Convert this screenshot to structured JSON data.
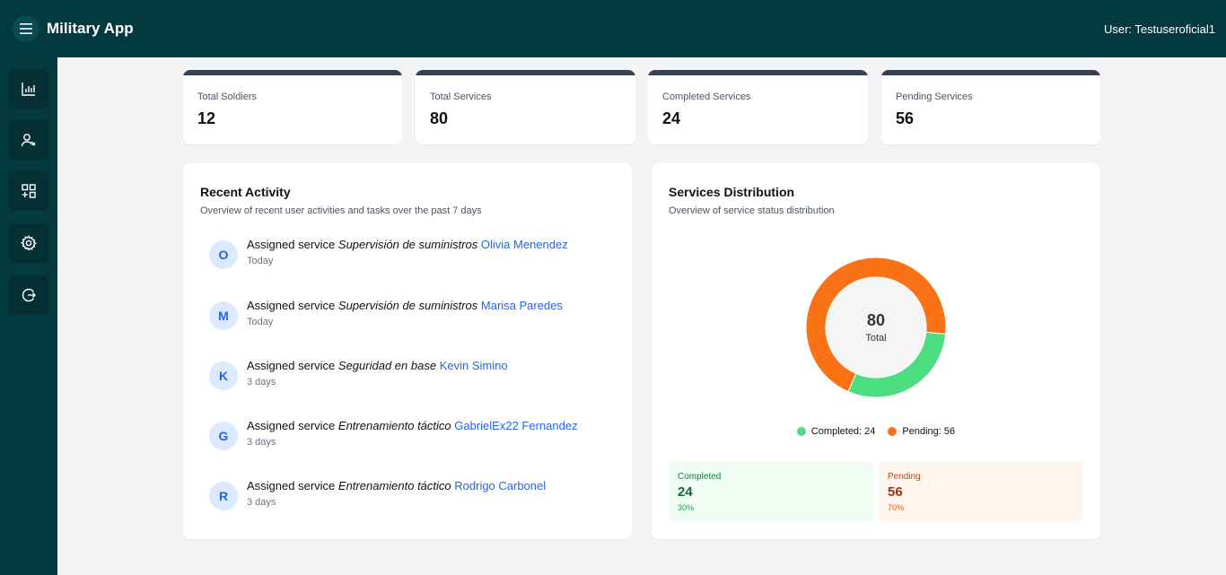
{
  "header": {
    "app_title": "Military App",
    "user_label": "User: Testuseroficial1"
  },
  "sidebar": {
    "items": [
      {
        "icon": "bar-chart-icon"
      },
      {
        "icon": "users-icon"
      },
      {
        "icon": "grid-add-icon"
      },
      {
        "icon": "gear-icon"
      },
      {
        "icon": "logout-icon"
      }
    ]
  },
  "stats": [
    {
      "label": "Total Soldiers",
      "value": "12"
    },
    {
      "label": "Total Services",
      "value": "80"
    },
    {
      "label": "Completed Services",
      "value": "24"
    },
    {
      "label": "Pending Services",
      "value": "56"
    }
  ],
  "activity": {
    "title": "Recent Activity",
    "subtitle": "Overview of recent user activities and tasks over the past 7 days",
    "action_text": "Assigned service",
    "items": [
      {
        "initial": "O",
        "service": "Supervisión de suministros",
        "user": "Olivia Menendez",
        "time": "Today"
      },
      {
        "initial": "M",
        "service": "Supervisión de suministros",
        "user": "Marisa Paredes",
        "time": "Today"
      },
      {
        "initial": "K",
        "service": "Seguridad en base",
        "user": "Kevin Simino",
        "time": "3 days"
      },
      {
        "initial": "G",
        "service": "Entrenamiento táctico",
        "user": "GabrielEx22 Fernandez",
        "time": "3 days"
      },
      {
        "initial": "R",
        "service": "Entrenamiento táctico",
        "user": "Rodrigo Carbonel",
        "time": "3 days"
      }
    ]
  },
  "distribution": {
    "title": "Services Distribution",
    "subtitle": "Overview of service status distribution",
    "total_value": "80",
    "total_label": "Total",
    "legend": {
      "completed": "Completed: 24",
      "pending": "Pending: 56"
    },
    "completed": {
      "label": "Completed",
      "value": "24",
      "pct": "30%"
    },
    "pending": {
      "label": "Pending",
      "value": "56",
      "pct": "70%"
    },
    "colors": {
      "completed": "#4ade80",
      "pending": "#f97316"
    }
  },
  "chart_data": {
    "type": "pie",
    "categories": [
      "Completed",
      "Pending"
    ],
    "values": [
      24,
      56
    ]
  }
}
